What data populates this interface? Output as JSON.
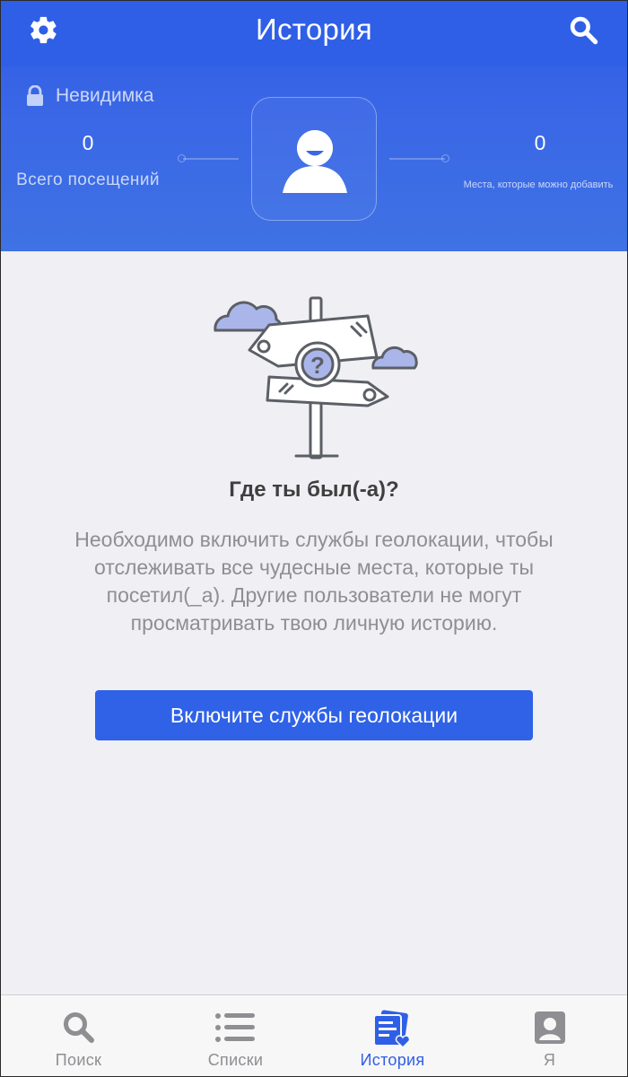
{
  "header": {
    "title": "История",
    "mode_label": "Невидимка",
    "stats": {
      "visits_value": "0",
      "visits_label": "Всего посещений",
      "addable_value": "0",
      "addable_label": "Места, которые можно добавить"
    }
  },
  "empty_state": {
    "heading": "Где ты был(-а)?",
    "description": "Необходимо включить службы геолокации, чтобы отслеживать все чудесные места, которые ты посетил(_а). Другие пользователи не могут просматривать твою личную историю.",
    "cta_label": "Включите службы геолокации"
  },
  "tabbar": {
    "items": [
      {
        "label": "Поиск",
        "icon": "search-icon",
        "active": false
      },
      {
        "label": "Списки",
        "icon": "list-icon",
        "active": false
      },
      {
        "label": "История",
        "icon": "history-icon",
        "active": true
      },
      {
        "label": "Я",
        "icon": "profile-icon",
        "active": false
      }
    ]
  },
  "colors": {
    "brand_blue": "#2f5fe6",
    "header_gradient_end": "#3f72e4",
    "background": "#f0eff4",
    "inactive_tab": "#8e8e93",
    "illustration_accent": "#aab6ea"
  }
}
